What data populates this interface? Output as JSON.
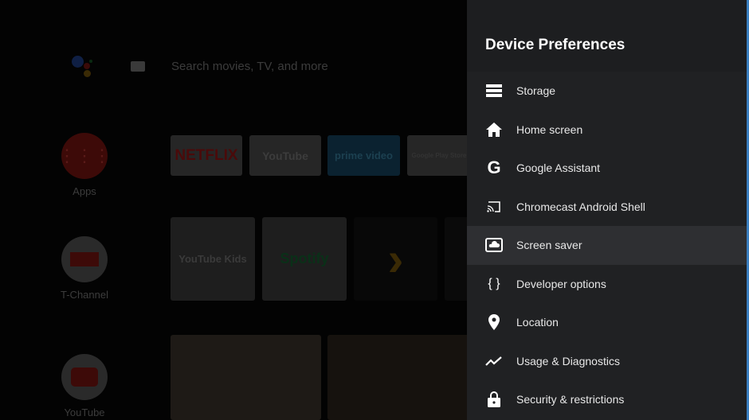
{
  "home": {
    "search_placeholder": "Search movies, TV, and more",
    "side_items": [
      {
        "label": "Apps",
        "icon": "apps-grid-icon"
      },
      {
        "label": "T-Channel",
        "icon": "t-channel-icon"
      },
      {
        "label": "YouTube",
        "icon": "youtube-icon"
      }
    ],
    "apps_row": [
      {
        "label": "NETFLIX",
        "color": "#5a0a0a"
      },
      {
        "label": "YouTube",
        "color": "#3c3c3c"
      },
      {
        "label": "prime video",
        "color": "#0c2a3a"
      },
      {
        "label": "Google Play Store",
        "color": "#3c3c3c"
      }
    ],
    "apps_row2": [
      {
        "label": "YouTube Kids"
      },
      {
        "label": "Spotify"
      }
    ]
  },
  "panel": {
    "title": "Device Preferences",
    "items": [
      {
        "label": "Storage",
        "icon": "storage-icon"
      },
      {
        "label": "Home screen",
        "icon": "home-icon"
      },
      {
        "label": "Google Assistant",
        "icon": "google-icon"
      },
      {
        "label": "Chromecast Android Shell",
        "icon": "cast-icon"
      },
      {
        "label": "Screen saver",
        "icon": "screensaver-icon",
        "selected": true
      },
      {
        "label": "Developer options",
        "icon": "braces-icon"
      },
      {
        "label": "Location",
        "icon": "location-pin-icon"
      },
      {
        "label": "Usage & Diagnostics",
        "icon": "trending-icon"
      },
      {
        "label": "Security & restrictions",
        "icon": "lock-icon"
      }
    ]
  },
  "colors": {
    "accent": "#3a7fc1",
    "panel_bg": "#202123",
    "selected_bg": "#2e2f32"
  }
}
